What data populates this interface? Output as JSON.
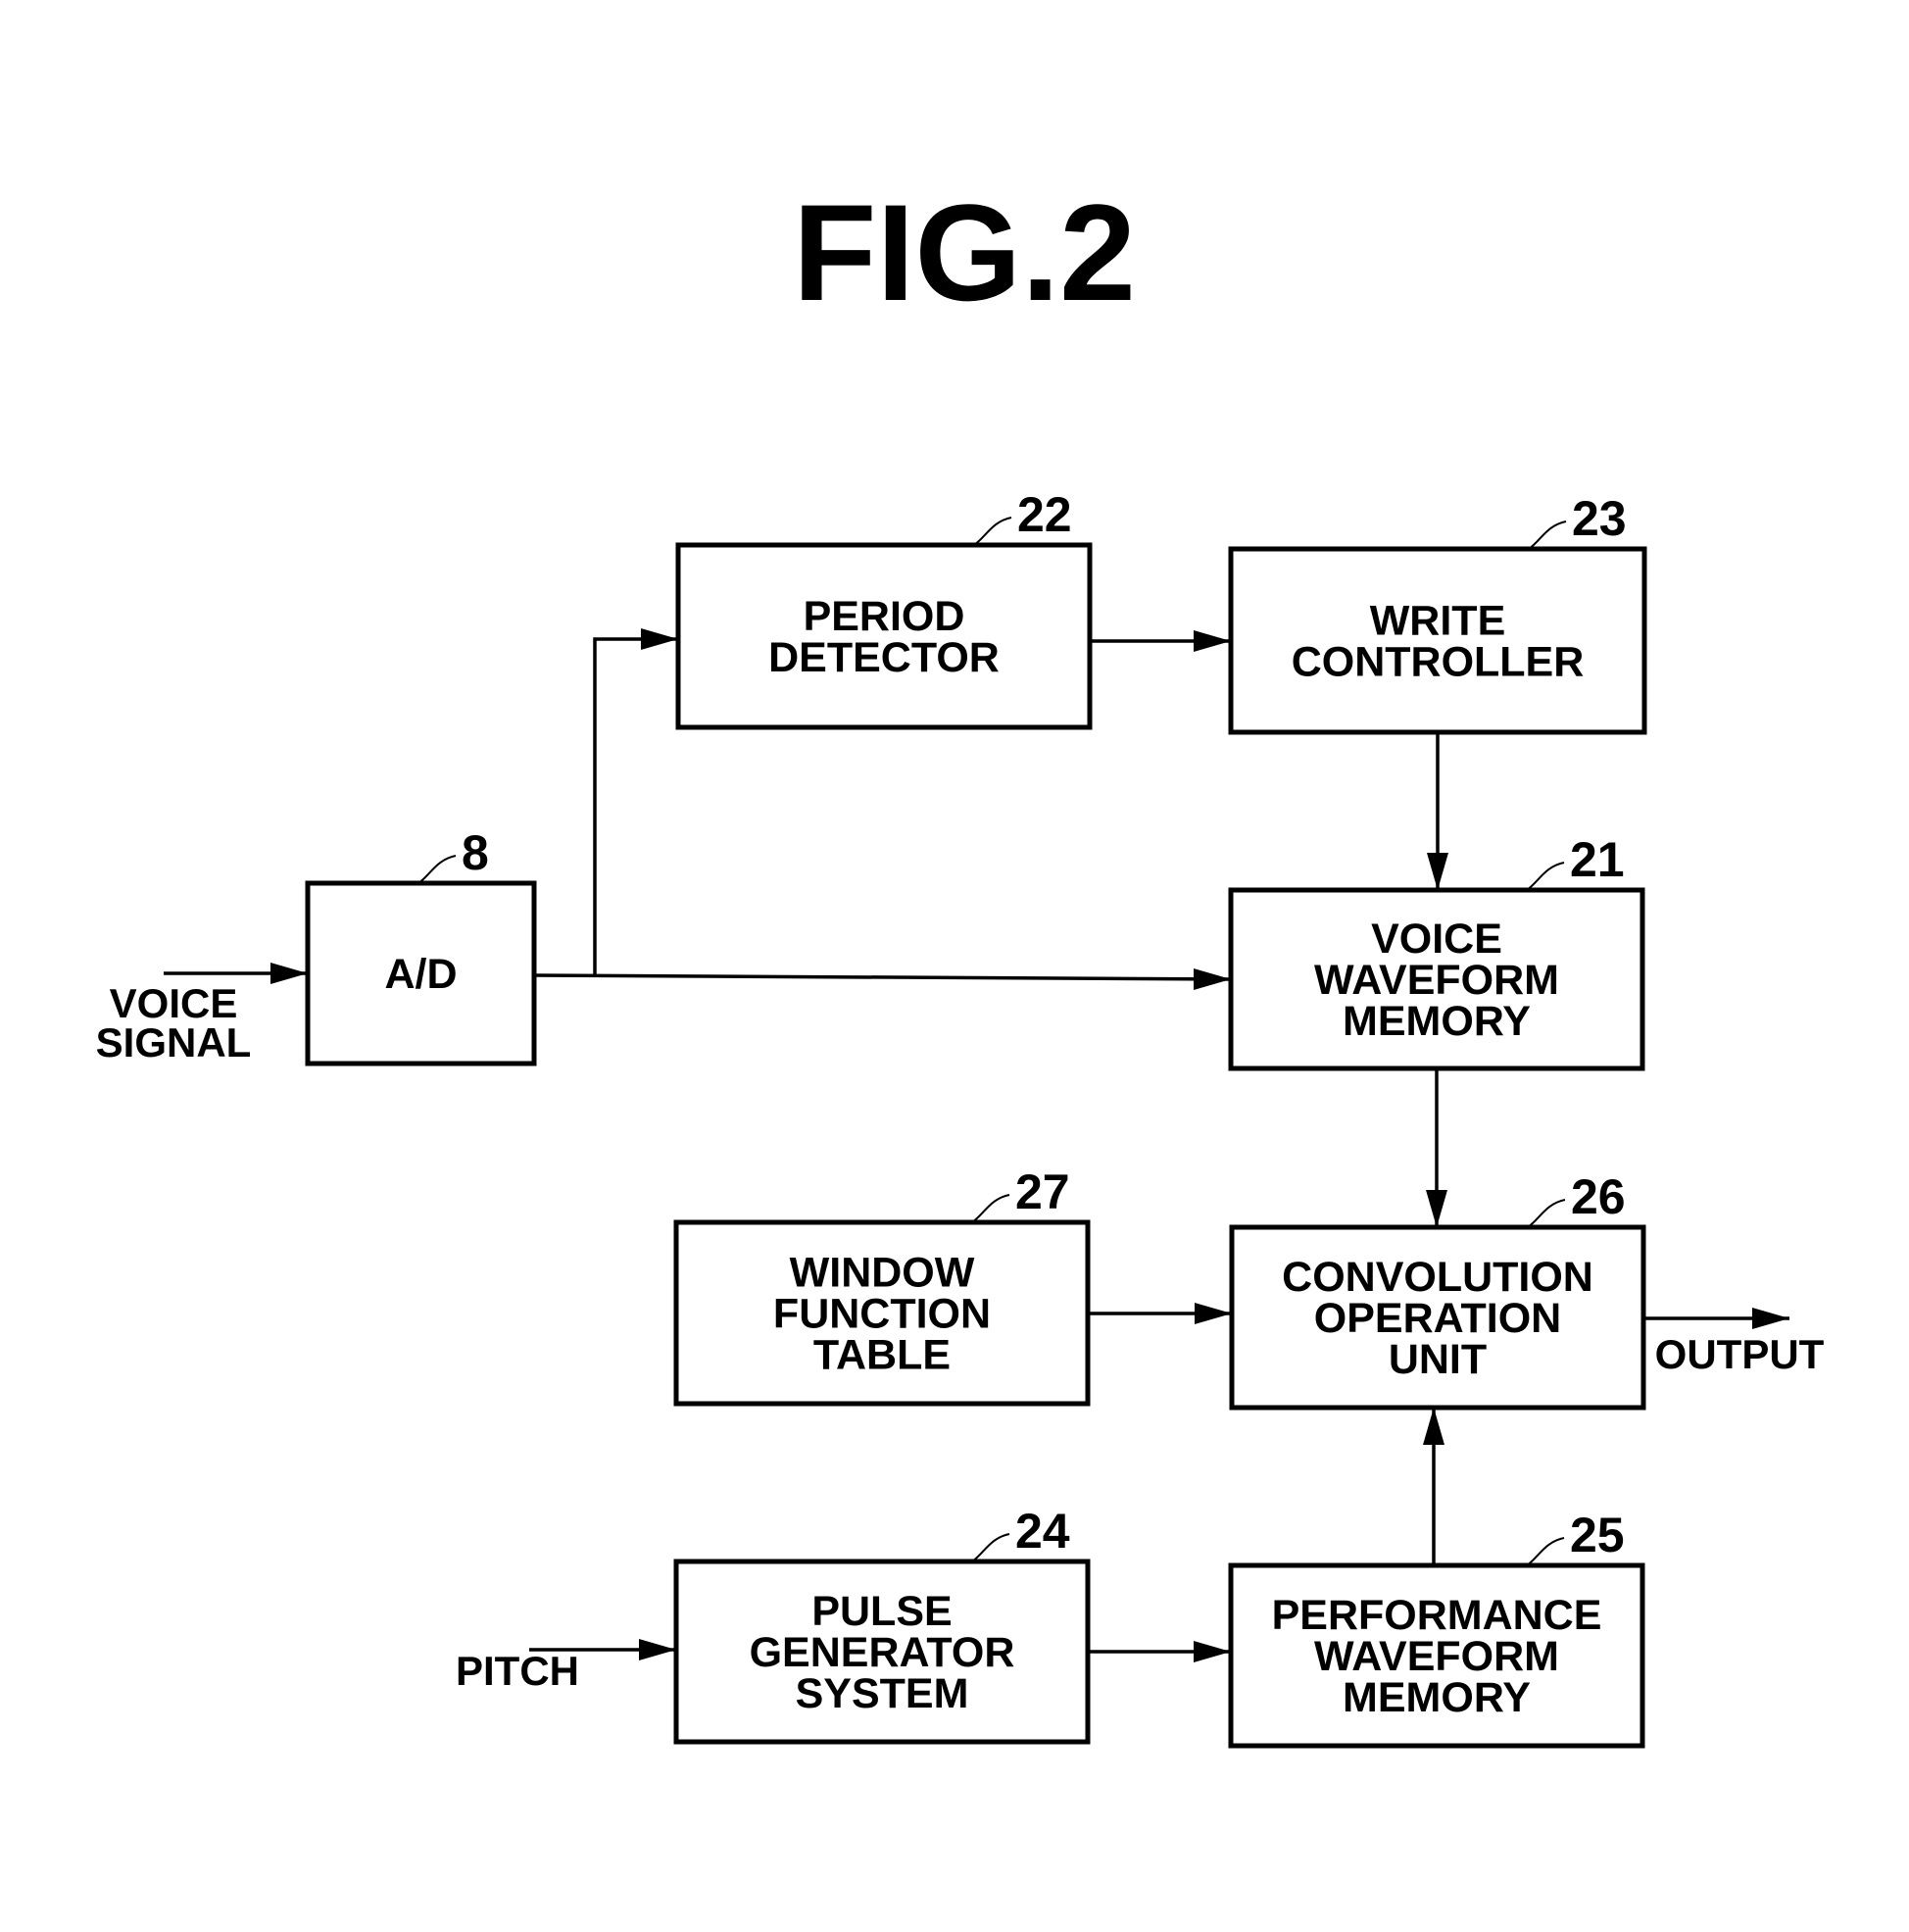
{
  "figure": {
    "title": "FIG.2"
  },
  "blocks": [
    {
      "id": "ad",
      "ref": "8",
      "lines": [
        "A/D"
      ]
    },
    {
      "id": "period-detector",
      "ref": "22",
      "lines": [
        "PERIOD",
        "DETECTOR"
      ]
    },
    {
      "id": "write-controller",
      "ref": "23",
      "lines": [
        "WRITE",
        "CONTROLLER"
      ]
    },
    {
      "id": "voice-waveform-memory",
      "ref": "21",
      "lines": [
        "VOICE",
        "WAVEFORM",
        "MEMORY"
      ]
    },
    {
      "id": "window-function-table",
      "ref": "27",
      "lines": [
        "WINDOW",
        "FUNCTION",
        "TABLE"
      ]
    },
    {
      "id": "convolution-operation-unit",
      "ref": "26",
      "lines": [
        "CONVOLUTION",
        "OPERATION",
        "UNIT"
      ]
    },
    {
      "id": "pulse-generator-system",
      "ref": "24",
      "lines": [
        "PULSE",
        "GENERATOR",
        "SYSTEM"
      ]
    },
    {
      "id": "performance-waveform-memory",
      "ref": "25",
      "lines": [
        "PERFORMANCE",
        "WAVEFORM",
        "MEMORY"
      ]
    }
  ],
  "io_labels": {
    "voice_signal": [
      "VOICE",
      "SIGNAL"
    ],
    "pitch": [
      "PITCH"
    ],
    "output": [
      "OUTPUT"
    ]
  },
  "connections": [
    {
      "from": "voice_signal",
      "to": "ad"
    },
    {
      "from": "ad",
      "to": "period-detector"
    },
    {
      "from": "ad",
      "to": "voice-waveform-memory"
    },
    {
      "from": "period-detector",
      "to": "write-controller"
    },
    {
      "from": "write-controller",
      "to": "voice-waveform-memory"
    },
    {
      "from": "voice-waveform-memory",
      "to": "convolution-operation-unit"
    },
    {
      "from": "window-function-table",
      "to": "convolution-operation-unit"
    },
    {
      "from": "performance-waveform-memory",
      "to": "convolution-operation-unit"
    },
    {
      "from": "pitch",
      "to": "pulse-generator-system"
    },
    {
      "from": "pulse-generator-system",
      "to": "performance-waveform-memory"
    },
    {
      "from": "convolution-operation-unit",
      "to": "output"
    }
  ]
}
